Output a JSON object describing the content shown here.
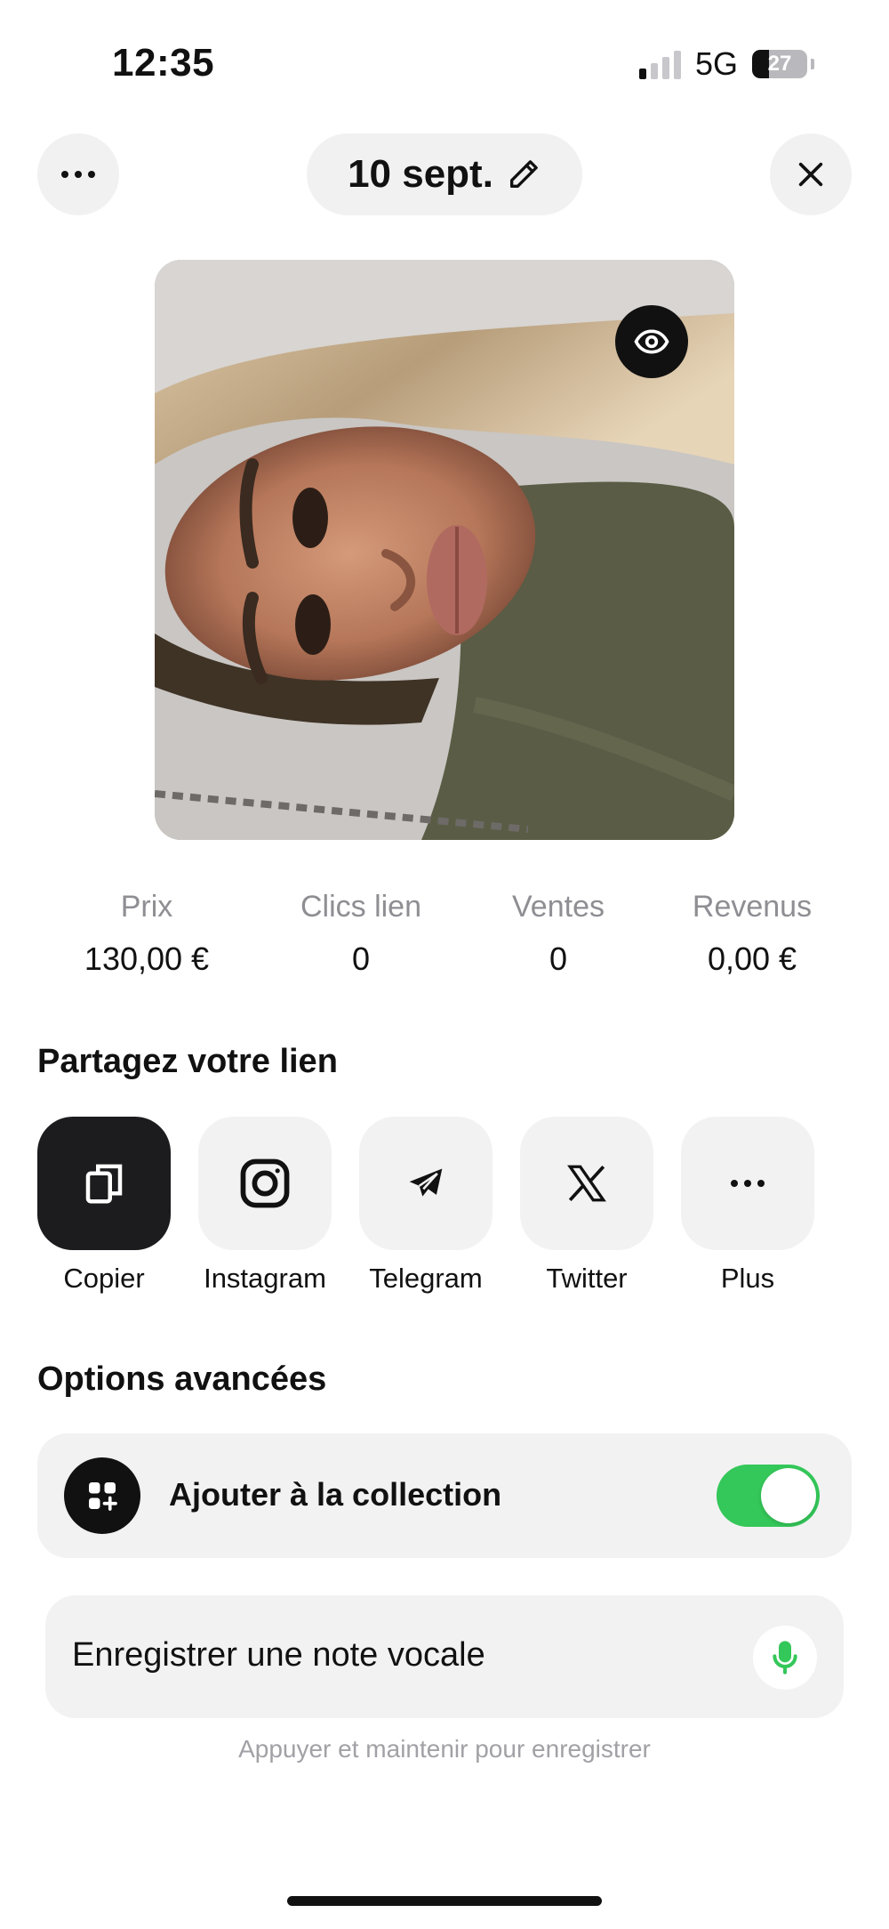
{
  "status_bar": {
    "time": "12:35",
    "network": "5G",
    "battery": "27"
  },
  "header": {
    "date": "10 sept."
  },
  "stats": [
    {
      "label": "Prix",
      "value": "130,00 €"
    },
    {
      "label": "Clics lien",
      "value": "0"
    },
    {
      "label": "Ventes",
      "value": "0"
    },
    {
      "label": "Revenus",
      "value": "0,00 €"
    }
  ],
  "share": {
    "title": "Partagez votre lien",
    "items": [
      {
        "label": "Copier",
        "icon": "copy-icon"
      },
      {
        "label": "Instagram",
        "icon": "instagram-icon"
      },
      {
        "label": "Telegram",
        "icon": "telegram-icon"
      },
      {
        "label": "Twitter",
        "icon": "x-twitter-icon"
      },
      {
        "label": "Plus",
        "icon": "more-icon"
      }
    ]
  },
  "options": {
    "title": "Options avancées",
    "collection": {
      "label": "Ajouter à la collection",
      "enabled": true
    }
  },
  "voice_note": {
    "label": "Enregistrer une note vocale",
    "hint": "Appuyer et maintenir pour enregistrer"
  },
  "colors": {
    "toggle_on": "#34c759",
    "mic": "#34c759",
    "dark_tile": "#1c1c1e",
    "card_bg": "#f2f2f3"
  }
}
